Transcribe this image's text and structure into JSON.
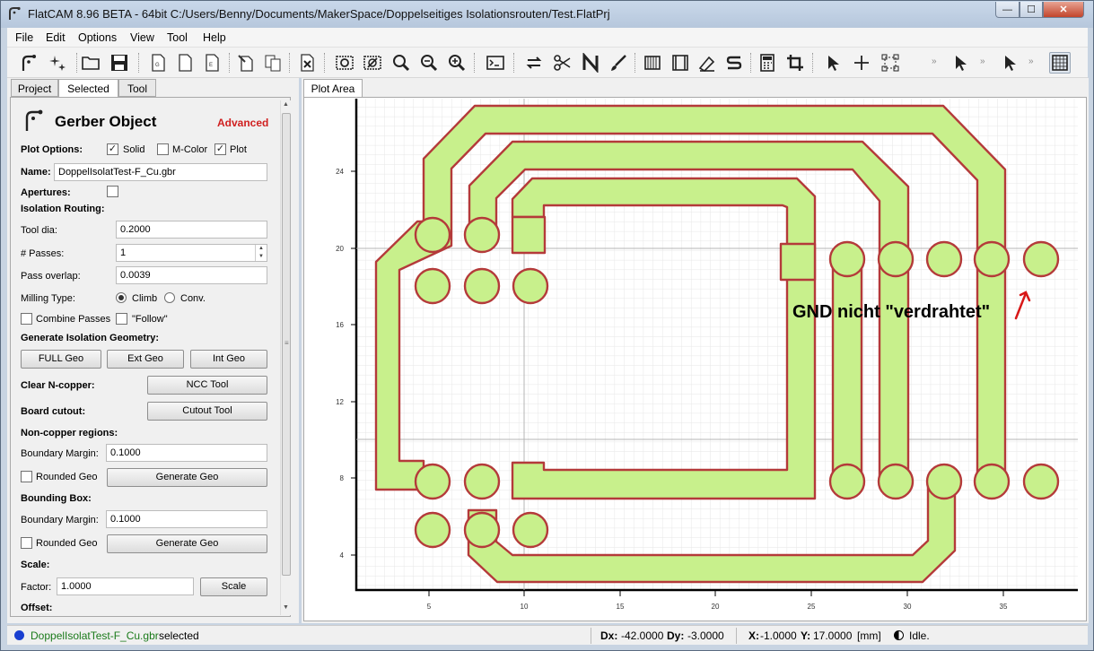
{
  "window": {
    "title": "FlatCAM 8.96 BETA - 64bit    C:/Users/Benny/Documents/MakerSpace/Doppelseitiges Isolationsrouten/Test.FlatPrj",
    "minimize": "—",
    "maximize": "☐",
    "close": "✕"
  },
  "menu": [
    {
      "label": "File"
    },
    {
      "label": "Edit"
    },
    {
      "label": "Options"
    },
    {
      "label": "View"
    },
    {
      "label": "Tool"
    },
    {
      "label": "Help"
    }
  ],
  "toolbar": {
    "overflow": "»"
  },
  "left_tabs": [
    {
      "label": "Project"
    },
    {
      "label": "Selected"
    },
    {
      "label": "Tool"
    }
  ],
  "plot_tab": "Plot Area",
  "panel": {
    "header": "Gerber Object",
    "mode": "Advanced",
    "plot_options": "Plot Options:",
    "solid": "Solid",
    "mcolor": "M-Color",
    "plot": "Plot",
    "name_label": "Name:",
    "name_value": "DoppelIsolatTest-F_Cu.gbr",
    "apertures": "Apertures:",
    "isolation_routing": "Isolation Routing:",
    "tool_dia_label": "Tool dia:",
    "tool_dia": "0.2000",
    "passes_label": "# Passes:",
    "passes": "1",
    "overlap_label": "Pass overlap:",
    "overlap": "0.0039",
    "milling_label": "Milling Type:",
    "climb": "Climb",
    "conv": "Conv.",
    "combine": "Combine Passes",
    "follow": "\"Follow\"",
    "gen_iso": "Generate Isolation Geometry:",
    "full_geo": "FULL Geo",
    "ext_geo": "Ext Geo",
    "int_geo": "Int Geo",
    "clear_ncopper": "Clear N-copper:",
    "ncc_tool": "NCC Tool",
    "board_cutout": "Board cutout:",
    "cutout_tool": "Cutout Tool",
    "noncopper": "Non-copper regions:",
    "boundary_margin_label": "Boundary Margin:",
    "boundary_margin": "0.1000",
    "rounded_geo": "Rounded Geo",
    "generate_geo": "Generate Geo",
    "bounding_box": "Bounding Box:",
    "bb_margin_label": "Boundary Margin:",
    "bb_margin": "0.1000",
    "bb_rounded": "Rounded Geo",
    "bb_generate": "Generate Geo",
    "scale": "Scale:",
    "factor_label": "Factor:",
    "factor": "1.0000",
    "scale_btn": "Scale",
    "offset": "Offset:"
  },
  "plot": {
    "y_ticks": [
      "24",
      "20",
      "16",
      "12",
      "8",
      "4"
    ],
    "x_ticks": [
      "5",
      "10",
      "15",
      "20",
      "25",
      "30",
      "35"
    ],
    "annotation": "GND nicht \"verdrahtet\"",
    "colors": {
      "copper": "#c8f08c",
      "outline": "#b43a3a",
      "arrow": "#d81818"
    }
  },
  "status": {
    "selected_file": "DoppelIsolatTest-F_Cu.gbr",
    "selected_word": "selected",
    "dx_label": "Dx:",
    "dx": "-42.0000",
    "dy_label": "Dy:",
    "dy": "-3.0000",
    "x_label": "X:",
    "x": "-1.0000",
    "y_label": "Y:",
    "y": "17.0000",
    "unit": "[mm]",
    "state": "Idle."
  }
}
